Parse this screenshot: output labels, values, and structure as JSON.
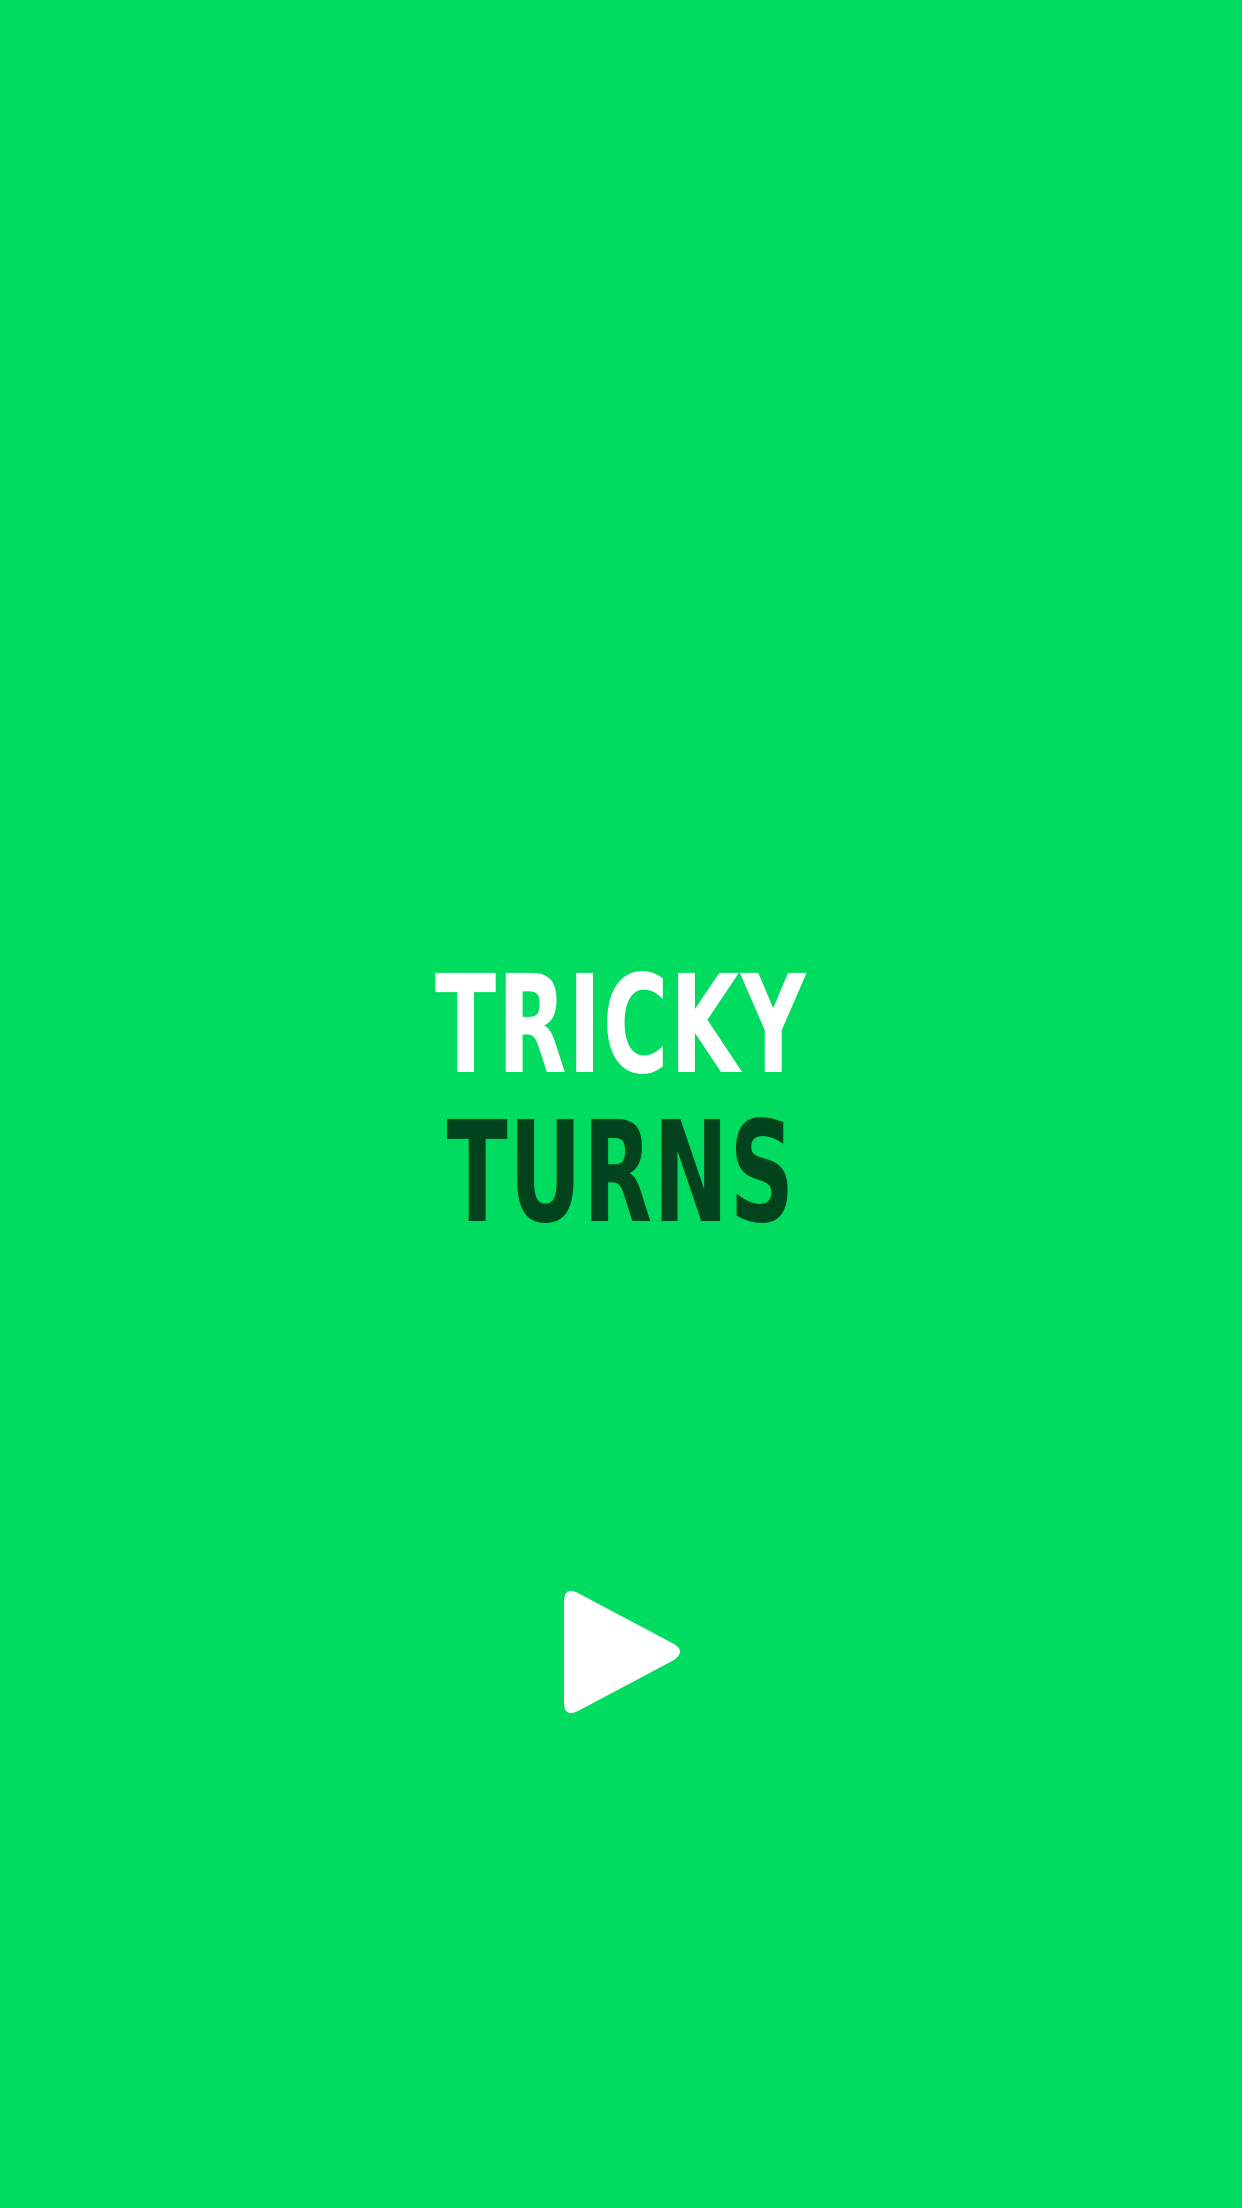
{
  "colors": {
    "background": "#00DC5F",
    "title_primary": "#FFFFFF",
    "title_secondary": "#00431C",
    "play_icon": "#FFFFFF"
  },
  "title": {
    "line1": "TRICKY",
    "line2": "TURNS"
  },
  "controls": {
    "play_icon": "play-icon"
  }
}
